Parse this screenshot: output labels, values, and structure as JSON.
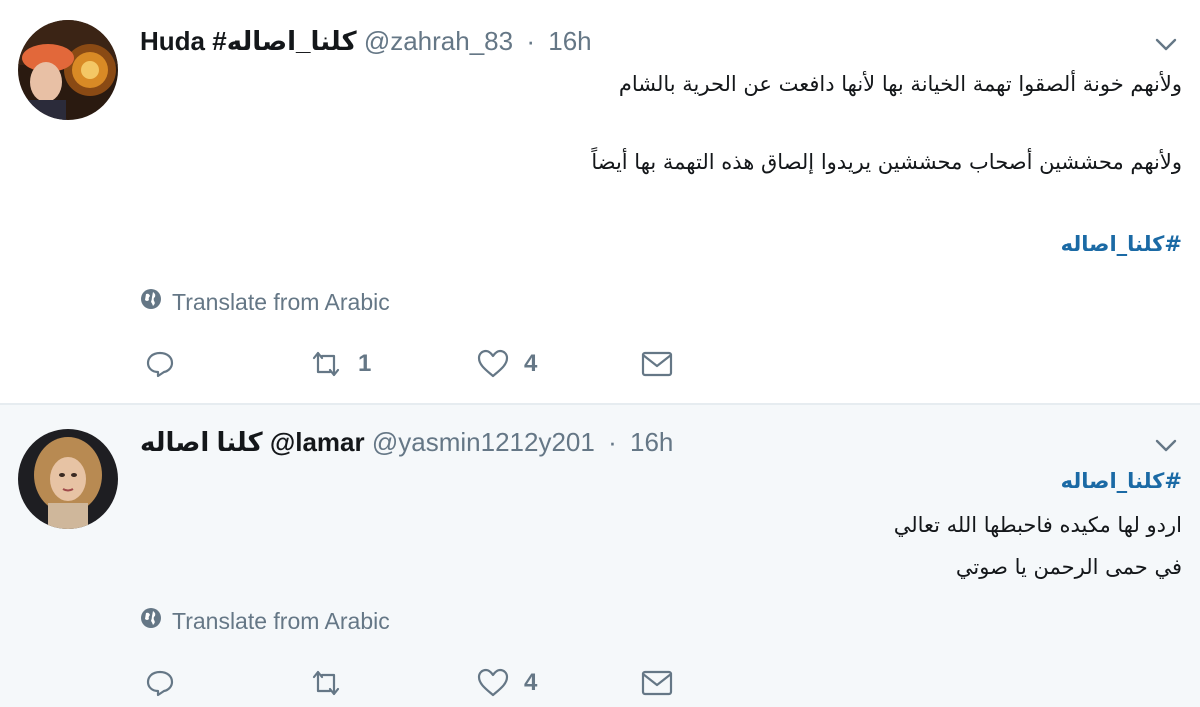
{
  "tweets": [
    {
      "display_name": "Huda #كلنا_اصاله",
      "handle": "@zahrah_83",
      "separator": "·",
      "time": "16h",
      "lines": [
        "ولأنهم خونة ألصقوا تهمة الخيانة بها لأنها دافعت عن الحرية بالشام",
        "ولأنهم محششين أصحاب محششين يريدوا إلصاق هذه التهمة بها أيضاً"
      ],
      "hashtag": "#كلنا_اصاله",
      "translate_label": "Translate from Arabic",
      "reply_count": "",
      "retweet_count": "1",
      "like_count": "4"
    },
    {
      "display_name": "كلنا اصاله @lamar",
      "handle": "@yasmin1212y201",
      "separator": "·",
      "time": "16h",
      "hashtag": "#كلنا_اصاله",
      "lines": [
        "اردو لها مكيده فاحبطها الله تعالي",
        "في حمى الرحمن يا صوتي"
      ],
      "translate_label": "Translate from Arabic",
      "reply_count": "",
      "retweet_count": "",
      "like_count": "4"
    }
  ],
  "colors": {
    "accent_link": "#1b6aa5",
    "muted": "#657786",
    "text": "#14171a",
    "reply_bg": "#f5f8fa"
  },
  "icons": [
    "chevron-down-icon",
    "globe-icon",
    "reply-icon",
    "retweet-icon",
    "like-icon",
    "direct-message-icon"
  ]
}
